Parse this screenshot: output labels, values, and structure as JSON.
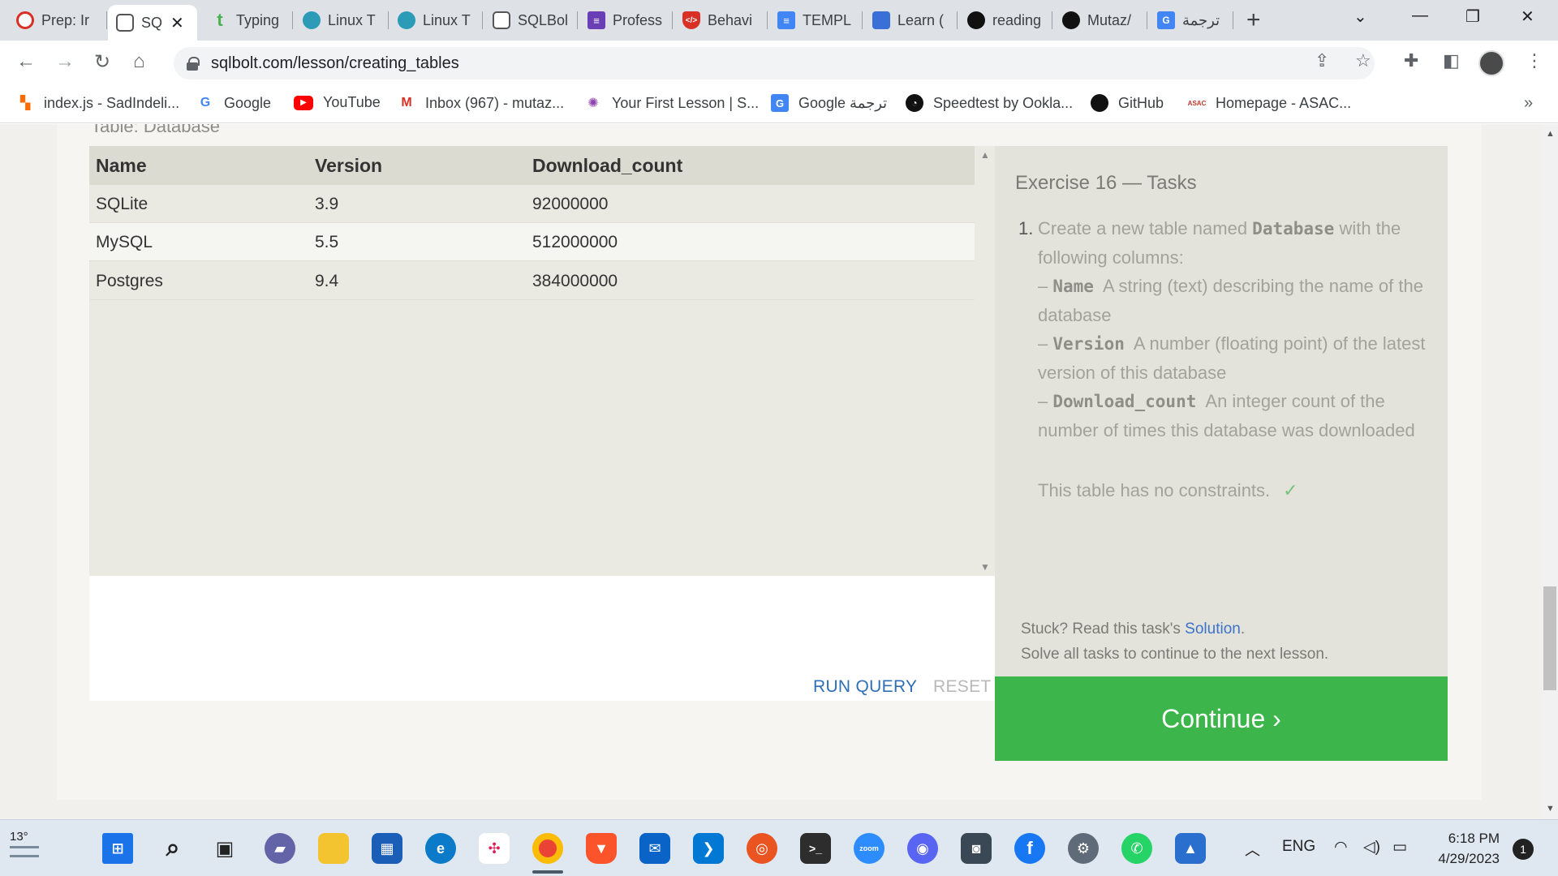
{
  "browser": {
    "tabs": [
      {
        "label": "Prep: Ir",
        "icon": "gear-red-icon",
        "color": "#d93025"
      },
      {
        "label": "SQ",
        "icon": "database-icon",
        "color": "#555555",
        "active": true
      },
      {
        "label": "Typing",
        "icon": "typing-t-icon",
        "color": "#4caf50"
      },
      {
        "label": "Linux T",
        "icon": "linux-circle-icon",
        "color": "#2b9bb8"
      },
      {
        "label": "Linux T",
        "icon": "linux-circle-icon",
        "color": "#2b9bb8"
      },
      {
        "label": "SQLBol",
        "icon": "database-icon",
        "color": "#555555"
      },
      {
        "label": "Profess",
        "icon": "list-icon",
        "color": "#6a3fb5"
      },
      {
        "label": "Behavi",
        "icon": "shield-code-icon",
        "color": "#d93025"
      },
      {
        "label": "TEMPL",
        "icon": "docs-icon",
        "color": "#4285f4"
      },
      {
        "label": "Learn (",
        "icon": "learn-icon",
        "color": "#3b6fd8"
      },
      {
        "label": "reading",
        "icon": "github-icon",
        "color": "#111111"
      },
      {
        "label": "Mutaz/",
        "icon": "github-icon",
        "color": "#111111"
      },
      {
        "label": "ترجمة e",
        "icon": "translate-icon",
        "color": "#4285f4"
      }
    ],
    "url": "sqlbolt.com/lesson/creating_tables",
    "bookmarks": [
      {
        "label": "index.js - SadIndeli...",
        "icon": "codesandbox-icon",
        "color": "#ff6a00"
      },
      {
        "label": "Google",
        "icon": "google-icon",
        "color": "#4285f4"
      },
      {
        "label": "YouTube",
        "icon": "youtube-icon",
        "color": "#ff0000"
      },
      {
        "label": "Inbox (967) - mutaz...",
        "icon": "gmail-icon",
        "color": "#d93025"
      },
      {
        "label": "Your First Lesson | S...",
        "icon": "swirl-icon",
        "color": "#8e44ad"
      },
      {
        "label": "Google ترجمة",
        "icon": "translate-icon",
        "color": "#4285f4"
      },
      {
        "label": "Speedtest by Ookla...",
        "icon": "speedtest-icon",
        "color": "#111111"
      },
      {
        "label": "GitHub",
        "icon": "github-icon",
        "color": "#111111"
      },
      {
        "label": "Homepage - ASAC...",
        "icon": "asac-icon",
        "color": "#c0392b"
      }
    ]
  },
  "page": {
    "cut_label": "Table: Database",
    "table": {
      "columns": [
        "Name",
        "Version",
        "Download_count"
      ],
      "rows": [
        [
          "SQLite",
          "3.9",
          "92000000"
        ],
        [
          "MySQL",
          "5.5",
          "512000000"
        ],
        [
          "Postgres",
          "9.4",
          "384000000"
        ]
      ]
    },
    "run_label": "RUN QUERY",
    "reset_label": "RESET",
    "exercise": {
      "title": "Exercise 16 — Tasks",
      "task_number": "1.",
      "task_intro_a": "Create a new table named ",
      "task_intro_code": "Database",
      "task_intro_b": " with the following columns:",
      "dash": "– ",
      "columns": [
        {
          "code": "Name",
          "desc": "A string (text) describing the name of the database"
        },
        {
          "code": "Version",
          "desc": "A number (floating point) of the latest version of this database"
        },
        {
          "code": "Download_count",
          "desc": "An integer count of the number of times this database was downloaded"
        }
      ],
      "constraint": "This table has no constraints.",
      "check": "✓",
      "stuck_prefix": "Stuck? Read this task's ",
      "stuck_link": "Solution",
      "stuck_suffix": ".",
      "solve_all": "Solve all tasks to continue to the next lesson.",
      "continue_label": "Continue ›"
    }
  },
  "taskbar": {
    "weather": "13°",
    "lang": "ENG",
    "time": "6:18 PM",
    "date": "4/29/2023",
    "notifications": "1"
  }
}
